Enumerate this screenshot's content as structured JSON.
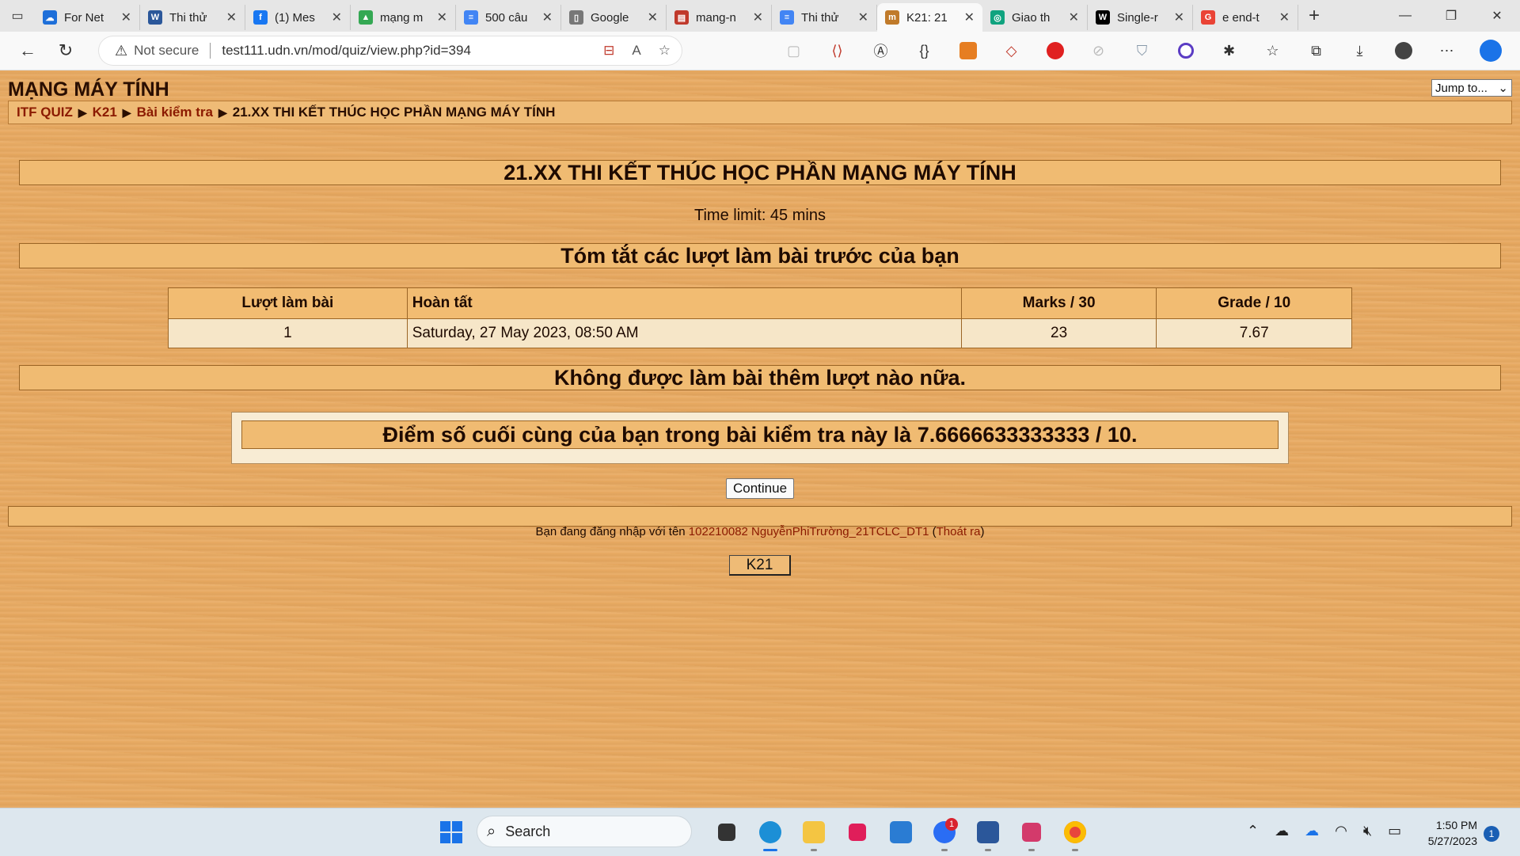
{
  "browser": {
    "tabs": [
      {
        "label": "For Net",
        "color": "#1e6fd9",
        "glyph": "☁"
      },
      {
        "label": "Thi thử",
        "color": "#2b579a",
        "glyph": "W"
      },
      {
        "label": "(1) Mes",
        "color": "#1877f2",
        "glyph": "f"
      },
      {
        "label": "mạng m",
        "color": "#34a853",
        "glyph": "▲"
      },
      {
        "label": "500 câu",
        "color": "#4285f4",
        "glyph": "≡"
      },
      {
        "label": "Google",
        "color": "#777777",
        "glyph": "▯"
      },
      {
        "label": "mang-n",
        "color": "#c0392b",
        "glyph": "▤"
      },
      {
        "label": "Thi thử",
        "color": "#4285f4",
        "glyph": "≡"
      },
      {
        "label": "K21: 21",
        "color": "#c07a2a",
        "glyph": "m"
      },
      {
        "label": "Giao th",
        "color": "#10a37f",
        "glyph": "◎"
      },
      {
        "label": "Single-r",
        "color": "#000000",
        "glyph": "W"
      },
      {
        "label": "e end-t",
        "color": "#ea4335",
        "glyph": "G"
      }
    ],
    "active_tab_index": 8,
    "address": {
      "security_label": "Not secure",
      "url": "test111.udn.vn/mod/quiz/view.php?id=394"
    }
  },
  "page": {
    "site_title": "MẠNG MÁY TÍNH",
    "jump_to": "Jump to...",
    "breadcrumb": [
      "ITF QUIZ",
      "K21",
      "Bài kiểm tra",
      "21.XX THI KẾT THÚC HỌC PHẦN MẠNG MÁY TÍNH"
    ],
    "quiz_title": "21.XX THI KẾT THÚC HỌC PHẦN MẠNG MÁY TÍNH",
    "time_limit": "Time limit: 45 mins",
    "summary_heading": "Tóm tắt các lượt làm bài trước của bạn",
    "table": {
      "headers": [
        "Lượt làm bài",
        "Hoàn tất",
        "Marks / 30",
        "Grade / 10"
      ],
      "rows": [
        [
          "1",
          "Saturday, 27 May 2023, 08:50 AM",
          "23",
          "7.67"
        ]
      ]
    },
    "no_more_attempts": "Không được làm bài thêm lượt nào nữa.",
    "final_grade": "Điểm số cuối cùng của bạn trong bài kiểm tra này là 7.6666633333333 / 10.",
    "continue_label": "Continue",
    "login_prefix": "Bạn đang đăng nhập với tên ",
    "login_user": "102210082 NguyễnPhiTrường_21TCLC_DT1",
    "logout_label": "Thoát ra",
    "home_label": "K21"
  },
  "taskbar": {
    "search_label": "Search",
    "time": "1:50 PM",
    "date": "5/27/2023",
    "notification_count": "1",
    "zalo_badge": "1"
  }
}
